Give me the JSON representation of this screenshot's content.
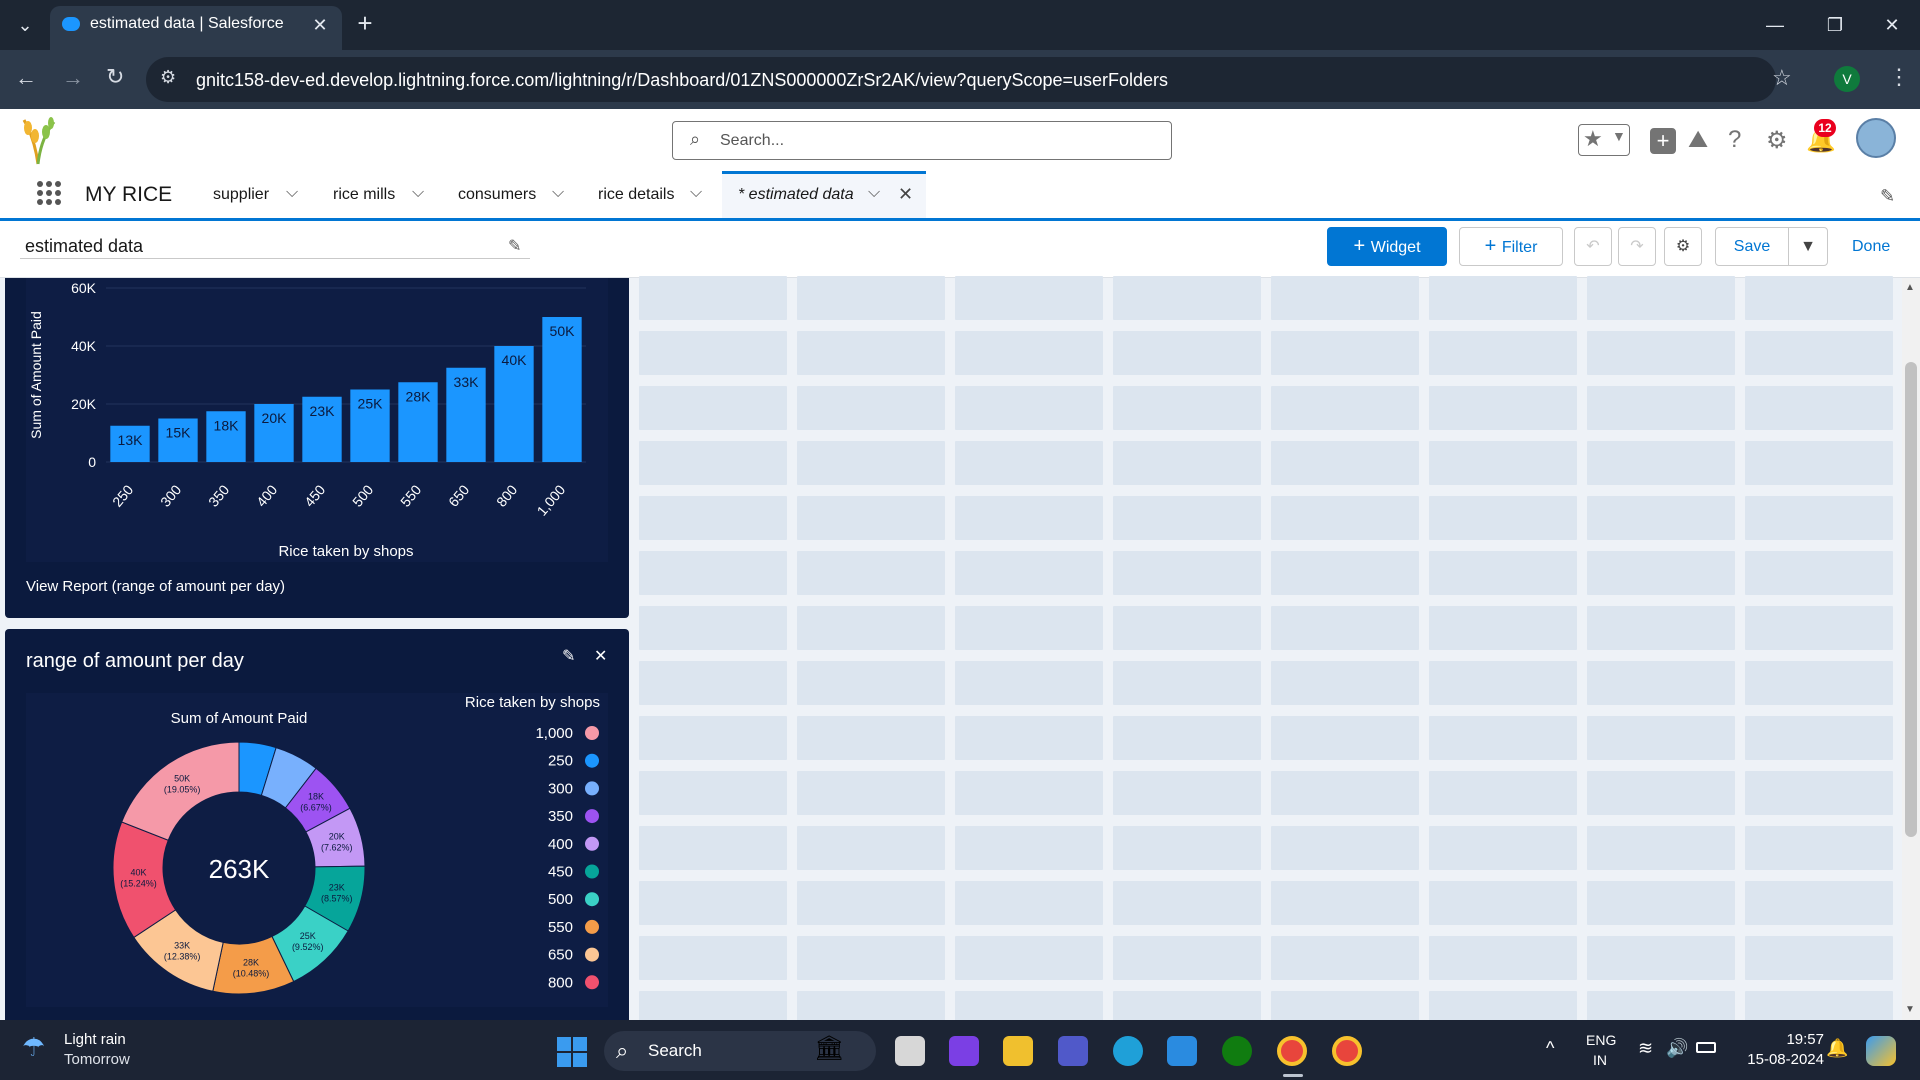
{
  "browser": {
    "tab_title": "estimated data | Salesforce",
    "url": "gnitc158-dev-ed.develop.lightning.force.com/lightning/r/Dashboard/01ZNS000000ZrSr2AK/view?queryScope=userFolders",
    "profile_initial": "V"
  },
  "header": {
    "search_placeholder": "Search...",
    "notification_count": "12"
  },
  "nav": {
    "app_name": "MY RICE",
    "items": [
      "supplier",
      "rice mills",
      "consumers",
      "rice details"
    ],
    "active_tab": "* estimated data"
  },
  "dashboard": {
    "name": "estimated data",
    "widget_label": "Widget",
    "filter_label": "Filter",
    "save_label": "Save",
    "done_label": "Done"
  },
  "widget1": {
    "footer_link": "View Report (range of amount per day)"
  },
  "widget2": {
    "title": "range of amount per day"
  },
  "colors": {
    "bar": "#1b96ff",
    "accent": "#0176d3",
    "widget_bg": "#0b1a3e"
  },
  "chart_data": [
    {
      "type": "bar",
      "categories": [
        "250",
        "300",
        "350",
        "400",
        "450",
        "500",
        "550",
        "650",
        "800",
        "1,000"
      ],
      "values": [
        12500,
        15000,
        17500,
        20000,
        22500,
        25000,
        27500,
        32500,
        40000,
        50000
      ],
      "data_labels": [
        "13K",
        "15K",
        "18K",
        "20K",
        "23K",
        "25K",
        "28K",
        "33K",
        "40K",
        "50K"
      ],
      "xlabel": "Rice taken by shops",
      "ylabel": "Sum of Amount Paid",
      "yticks": [
        "0",
        "20K",
        "40K",
        "60K"
      ],
      "ylim": [
        0,
        60000
      ]
    },
    {
      "type": "pie",
      "title": "Sum of Amount Paid",
      "center_label": "263K",
      "legend_title": "Rice taken by shops",
      "legend_placement": "right",
      "slices": [
        {
          "name": "250",
          "value": 12500,
          "color": "#1b96ff",
          "label": ""
        },
        {
          "name": "300",
          "value": 15000,
          "color": "#78b0fd",
          "label": ""
        },
        {
          "name": "350",
          "value": 17500,
          "color": "#9d53f2",
          "label": "18K\n(6.67%)"
        },
        {
          "name": "400",
          "value": 20000,
          "color": "#c398f5",
          "label": "20K\n(7.62%)"
        },
        {
          "name": "450",
          "value": 22500,
          "color": "#06a59a",
          "label": "23K\n(8.57%)"
        },
        {
          "name": "500",
          "value": 25000,
          "color": "#3ad1c6",
          "label": "25K\n(9.52%)"
        },
        {
          "name": "550",
          "value": 27500,
          "color": "#f49c49",
          "label": "28K\n(10.48%)"
        },
        {
          "name": "650",
          "value": 32500,
          "color": "#fcc694",
          "label": "33K\n(12.38%)"
        },
        {
          "name": "800",
          "value": 40000,
          "color": "#f0516e",
          "label": "40K\n(15.24%)"
        },
        {
          "name": "1,000",
          "value": 50000,
          "color": "#f599a8",
          "label": "50K\n(19.05%)"
        }
      ],
      "legend_order": [
        "1,000",
        "250",
        "300",
        "350",
        "400",
        "450",
        "500",
        "550",
        "650",
        "800"
      ]
    }
  ],
  "taskbar": {
    "weather_title": "Light rain",
    "weather_sub": "Tomorrow",
    "search_label": "Search",
    "lang_top": "ENG",
    "lang_bottom": "IN",
    "time": "19:57",
    "date": "15-08-2024"
  }
}
